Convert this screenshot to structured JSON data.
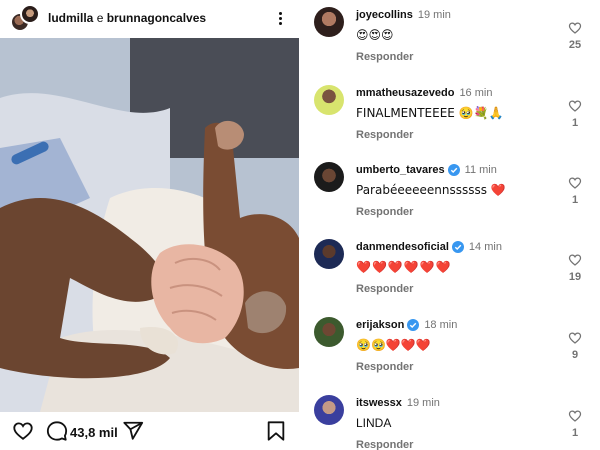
{
  "post": {
    "user1": "ludmilla",
    "connector": "e",
    "user2": "brunnagoncalves",
    "comment_count": "43,8 mil",
    "icons": {
      "more": "more-vertical-icon",
      "like": "heart-icon",
      "comment": "comment-bubble-icon",
      "share": "paper-plane-icon",
      "save": "bookmark-icon",
      "tag": "user-tag-icon"
    }
  },
  "comments": [
    {
      "username": "joyecollins",
      "verified": false,
      "time": "19 min",
      "text": "😍😍😍",
      "reply": "Responder",
      "likes": "25"
    },
    {
      "username": "mmatheusazevedo",
      "verified": false,
      "time": "16 min",
      "text": "FINALMENTEEEE 🥹💐🙏",
      "reply": "Responder",
      "likes": "1"
    },
    {
      "username": "umberto_tavares",
      "verified": true,
      "time": "11 min",
      "text": "Parabéeeeeennssssss ❤️",
      "reply": "Responder",
      "likes": "1"
    },
    {
      "username": "danmendesoficial",
      "verified": true,
      "time": "14 min",
      "text": "❤️❤️❤️❤️❤️❤️",
      "reply": "Responder",
      "likes": "19"
    },
    {
      "username": "erijakson",
      "verified": true,
      "time": "18 min",
      "text": "🥹🥹❤️❤️❤️",
      "reply": "Responder",
      "likes": "9"
    },
    {
      "username": "itswessx",
      "verified": false,
      "time": "19 min",
      "text": "LINDA",
      "reply": "Responder",
      "likes": "1"
    }
  ],
  "colors": {
    "verified": "#3897f0",
    "muted": "#737373",
    "heart_red": "#e0242c"
  }
}
